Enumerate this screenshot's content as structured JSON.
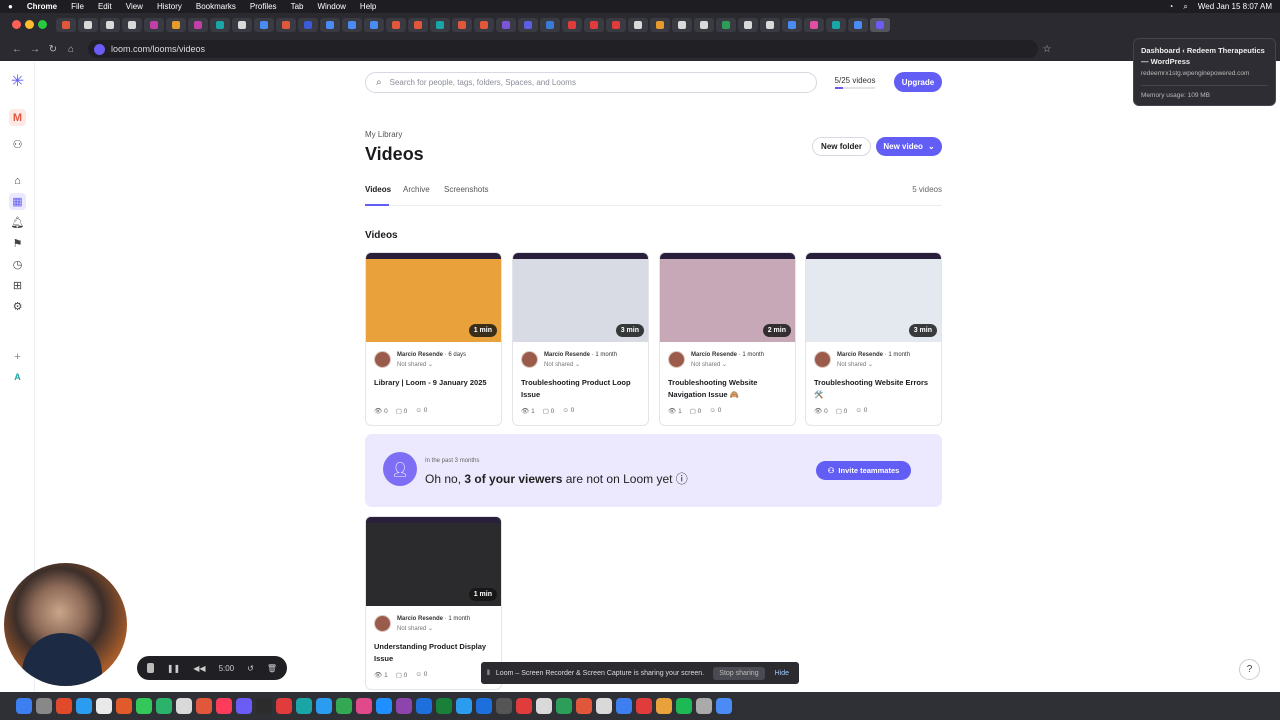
{
  "os_menubar": {
    "app": "Chrome",
    "items": [
      "File",
      "Edit",
      "View",
      "History",
      "Bookmarks",
      "Profiles",
      "Tab",
      "Window",
      "Help"
    ],
    "clock": "Wed Jan 15  8:07 AM"
  },
  "browser": {
    "url": "loom.com/looms/videos",
    "tab_colors": [
      "#e0573c",
      "#d9d9d9",
      "#d9d9d9",
      "#d9d9d9",
      "#c23ea8",
      "#e79b2c",
      "#c23ea8",
      "#1aa6a6",
      "#d9d9d9",
      "#4a8bf5",
      "#e0573c",
      "#3b5bd8",
      "#4a8bf5",
      "#4a8bf5",
      "#4a8bf5",
      "#e0573c",
      "#e0573c",
      "#1aa6a6",
      "#e0573c",
      "#e0573c",
      "#7a55d8",
      "#5b5fe0",
      "#3b7bd8",
      "#e03c3c",
      "#e03c3c",
      "#e03c3c",
      "#d9d9d9",
      "#e79b2c",
      "#d9d9d9",
      "#d9d9d9",
      "#2c9e5a",
      "#d9d9d9",
      "#d9d9d9",
      "#4a8bf5",
      "#e04fa0",
      "#1aa6a6",
      "#4a8bf5",
      "#6b5cf5"
    ],
    "tab_tooltip": {
      "title": "Dashboard ‹ Redeem Therapeutics — WordPress",
      "url": "redeemrx1stg.wpenginepowered.com",
      "memory": "Memory usage: 109 MB"
    }
  },
  "sidebar": {
    "workspace_initial": "M",
    "bottom_initial": "A"
  },
  "header": {
    "search_placeholder": "Search for people, tags, folders, Spaces, and Looms",
    "video_count": "5/25 videos",
    "video_quota_fraction": 0.2,
    "upgrade_label": "Upgrade"
  },
  "page": {
    "breadcrumb": "My Library",
    "title": "Videos",
    "new_folder_label": "New folder",
    "new_video_label": "New video",
    "tabs": [
      "Videos",
      "Archive",
      "Screenshots"
    ],
    "total": "5 videos",
    "section_title": "Videos"
  },
  "videos": [
    {
      "title": "Library | Loom - 9 January 2025",
      "owner": "Marcio Resende",
      "age": "· 6 days",
      "shared": "Not shared ⌄",
      "duration": "1 min",
      "views": "0",
      "comments": "0",
      "reactions": "0",
      "theme": "#e9a23b"
    },
    {
      "title": "Troubleshooting Product Loop Issue",
      "owner": "Marcio Resende",
      "age": "· 1 month",
      "shared": "Not shared ⌄",
      "duration": "3 min",
      "views": "1",
      "comments": "0",
      "reactions": "0",
      "theme": "#d8dbe3"
    },
    {
      "title": "Troubleshooting Website Navigation Issue 🙈",
      "owner": "Marcio Resende",
      "age": "· 1 month",
      "shared": "Not shared ⌄",
      "duration": "2 min",
      "views": "1",
      "comments": "0",
      "reactions": "0",
      "theme": "#c7a8b6"
    },
    {
      "title": "Troubleshooting Website Errors 🛠️",
      "owner": "Marcio Resende",
      "age": "· 1 month",
      "shared": "Not shared ⌄",
      "duration": "3 min",
      "views": "0",
      "comments": "0",
      "reactions": "0",
      "theme": "#e4e8ef"
    },
    {
      "title": "Understanding Product Display Issue",
      "owner": "Marcio Resende",
      "age": "· 1 month",
      "shared": "Not shared ⌄",
      "duration": "1 min",
      "views": "1",
      "comments": "0",
      "reactions": "0",
      "theme": "#2b2b2e"
    }
  ],
  "banner": {
    "small": "In the past 3 months",
    "lead": "Oh no, ",
    "bold": "3 of your viewers",
    "rest": " are not on Loom yet ⓘ",
    "invite_label": "Invite teammates"
  },
  "recorder": {
    "time": "5:00"
  },
  "share_bar": {
    "message": "Loom – Screen Recorder & Screen Capture is sharing your screen.",
    "stop_label": "Stop sharing",
    "hide_label": "Hide"
  },
  "dock_colors": [
    "#3d7ff0",
    "#888",
    "#e04a2a",
    "#2b9df0",
    "#e9e9e9",
    "#e05a2a",
    "#34c759",
    "#2bb36b",
    "#d9d9d9",
    "#e0573c",
    "#ff3b5c",
    "#6b5cf5",
    "#2c2c2c",
    "#e03c3c",
    "#1aa6a6",
    "#2b9df0",
    "#34a853",
    "#e04a8a",
    "#1e90ff",
    "#8e44ad",
    "#1d6fdc",
    "#188038",
    "#2b9df0",
    "#1d6fdc",
    "#555",
    "#e03c3c",
    "#d9d9d9",
    "#2c9e5a",
    "#e0573c",
    "#d9d9d9",
    "#3d7ff0",
    "#e03c3c",
    "#e9a23b",
    "#1db954",
    "#aaa",
    "#4a8bf5"
  ]
}
